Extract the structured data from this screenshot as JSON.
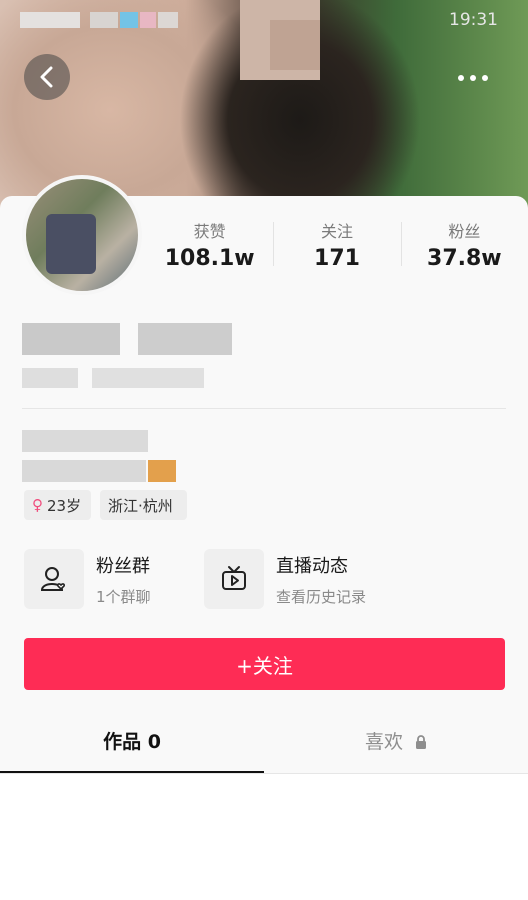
{
  "status_bar": {
    "time": "19:31"
  },
  "stats": [
    {
      "label": "获赞",
      "value": "108.1w"
    },
    {
      "label": "关注",
      "value": "171"
    },
    {
      "label": "粉丝",
      "value": "37.8w"
    }
  ],
  "tags": {
    "age": "23岁",
    "location": "浙江·杭州"
  },
  "features": {
    "fan_group": {
      "title": "粉丝群",
      "sub": "1个群聊"
    },
    "live": {
      "title": "直播动态",
      "sub": "查看历史记录"
    }
  },
  "follow_button": {
    "label": "+关注"
  },
  "tabs": {
    "works": "作品 0",
    "likes": "喜欢"
  },
  "colors": {
    "accent": "#fe2c55",
    "gender_female": "#f04d7d"
  },
  "icons": [
    "back-icon",
    "more-icon",
    "fan-group-icon",
    "live-tv-icon",
    "lock-icon"
  ]
}
